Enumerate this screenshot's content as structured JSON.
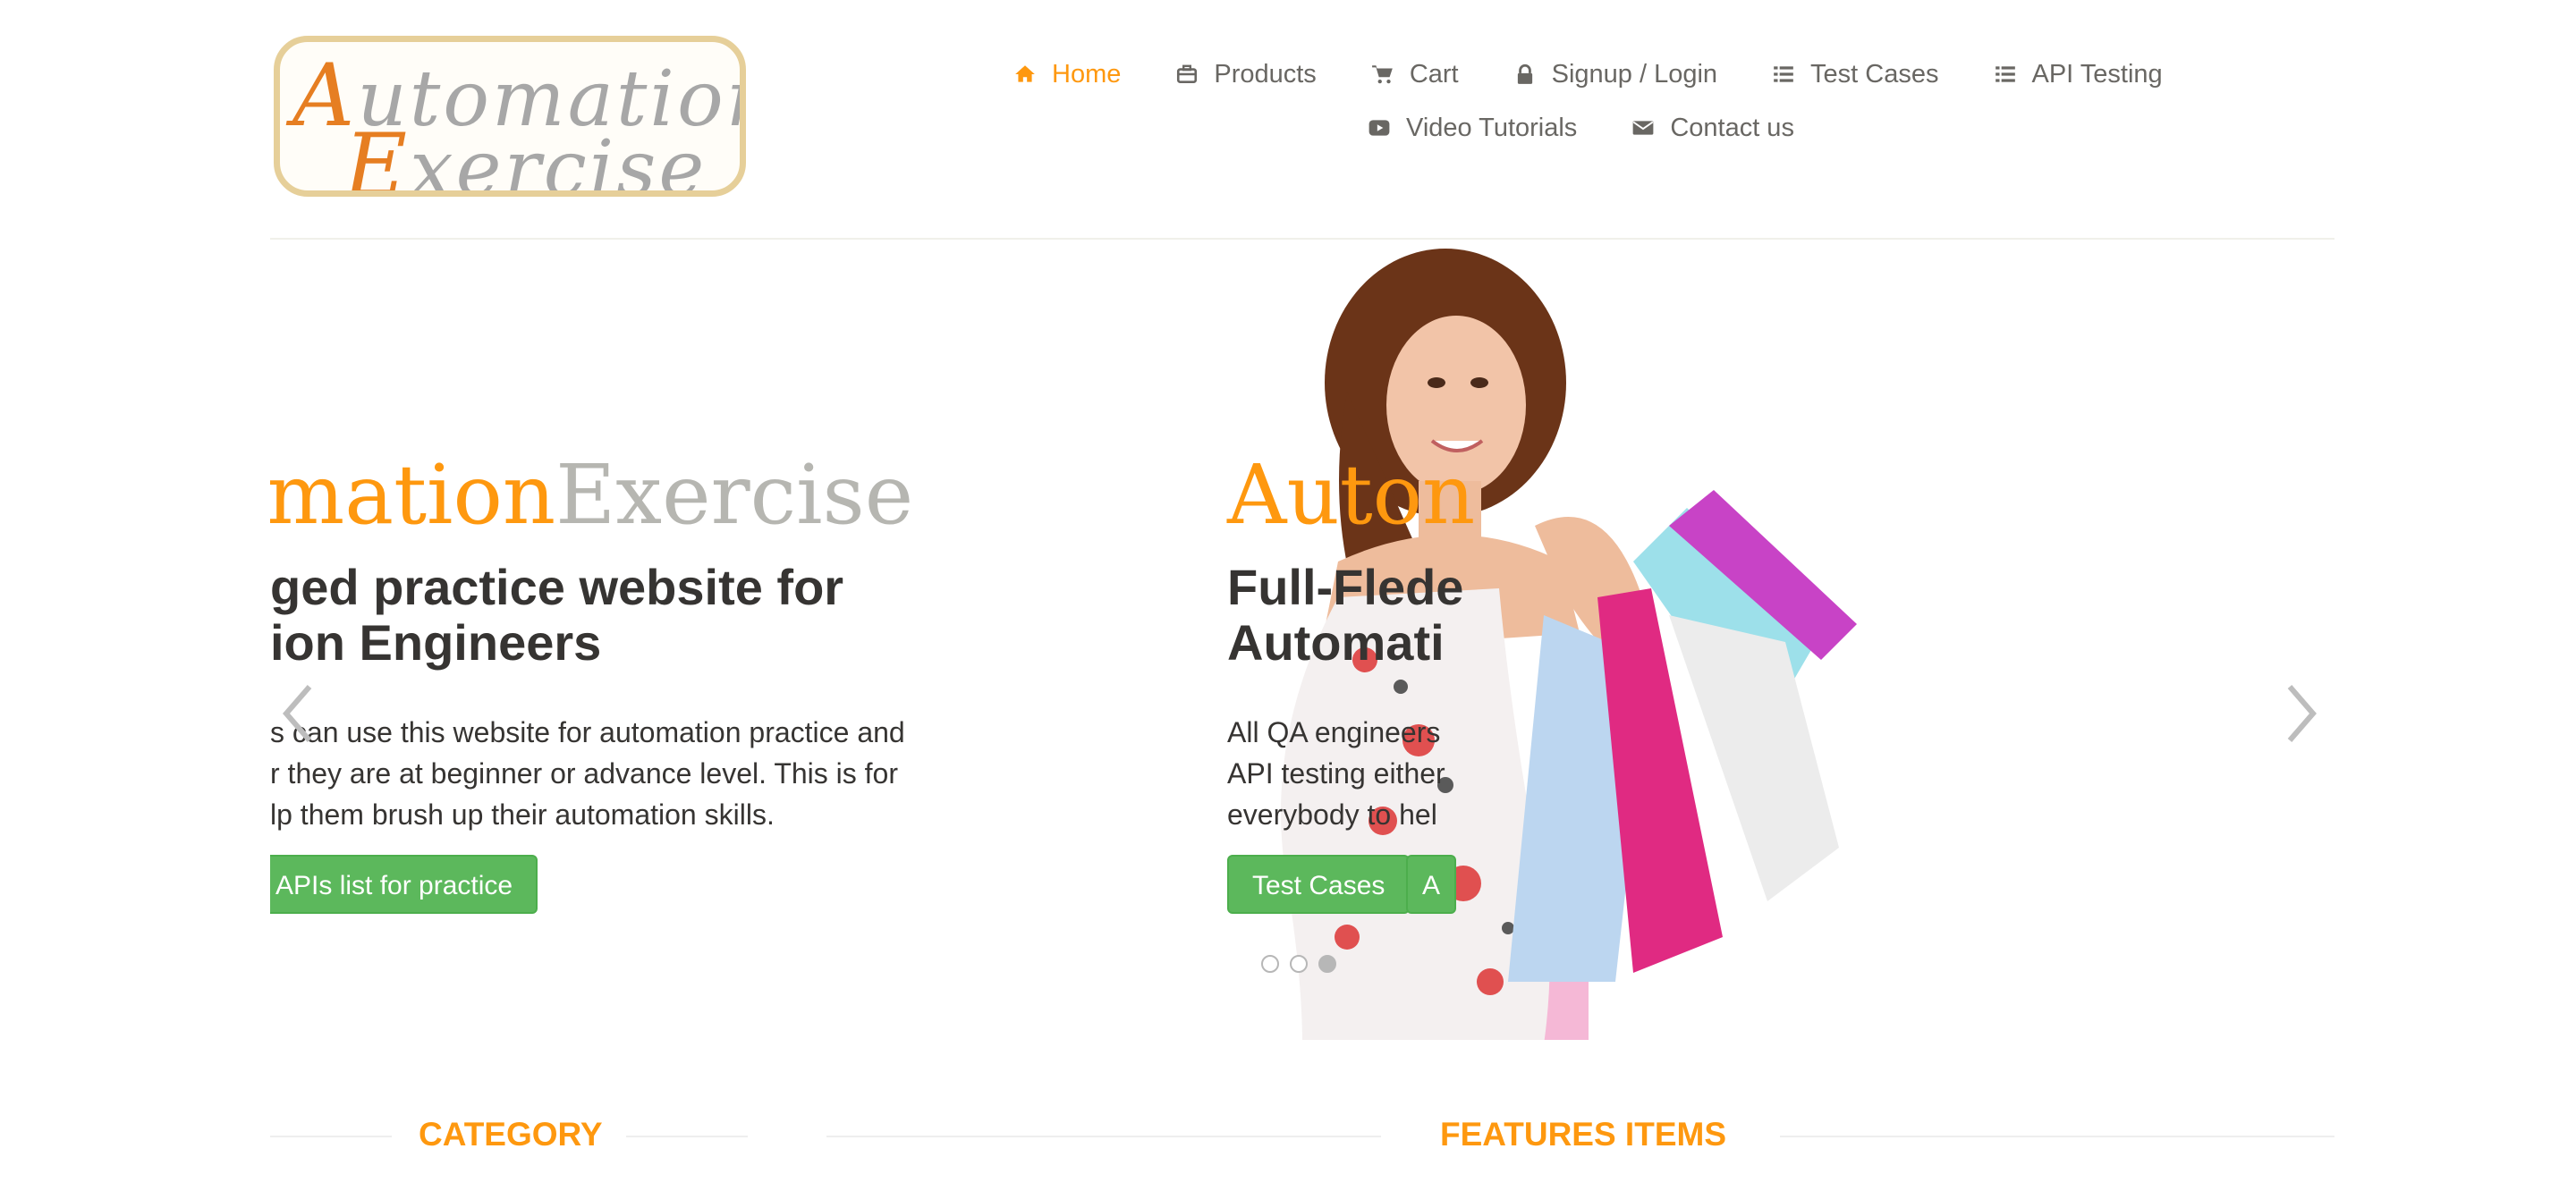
{
  "logo": {
    "line1_cap": "A",
    "line1_rest": "utomation",
    "line2_cap": "E",
    "line2_rest": "xercise"
  },
  "nav": {
    "items": [
      {
        "label": "Home",
        "icon": "home-icon",
        "active": true
      },
      {
        "label": "Products",
        "icon": "briefcase-icon"
      },
      {
        "label": "Cart",
        "icon": "cart-icon"
      },
      {
        "label": "Signup / Login",
        "icon": "lock-icon"
      },
      {
        "label": "Test Cases",
        "icon": "list-icon"
      },
      {
        "label": "API Testing",
        "icon": "list-icon"
      },
      {
        "label": "Video Tutorials",
        "icon": "youtube-play-icon"
      },
      {
        "label": "Contact us",
        "icon": "envelope-icon"
      }
    ]
  },
  "slider": {
    "left": {
      "brand_orange": "mation",
      "brand_gray": "Exercise",
      "heading_line1": "ged practice website for",
      "heading_line2": "ion Engineers",
      "para_line1": "s can use this website for automation practice and",
      "para_line2": "r they are at beginner or advance level. This is for",
      "para_line3": "lp them brush up their automation skills.",
      "button": "APIs list for practice"
    },
    "right": {
      "brand_orange": "Auton",
      "heading_line1": "Full-Flede",
      "heading_line2": "Automati",
      "para_line1": "All QA engineers",
      "para_line2": "API testing either",
      "para_line3": "everybody to hel",
      "button1": "Test Cases",
      "button2": "A"
    },
    "active_slide": 3,
    "slide_count": 3
  },
  "sections": {
    "left_title": "CATEGORY",
    "right_title": "FEATURES ITEMS"
  },
  "colors": {
    "accent": "#fe980f",
    "nav_text": "#696763",
    "button_green": "#5cb85c",
    "heading_text": "#363432",
    "logo_border": "#e6cf99"
  }
}
